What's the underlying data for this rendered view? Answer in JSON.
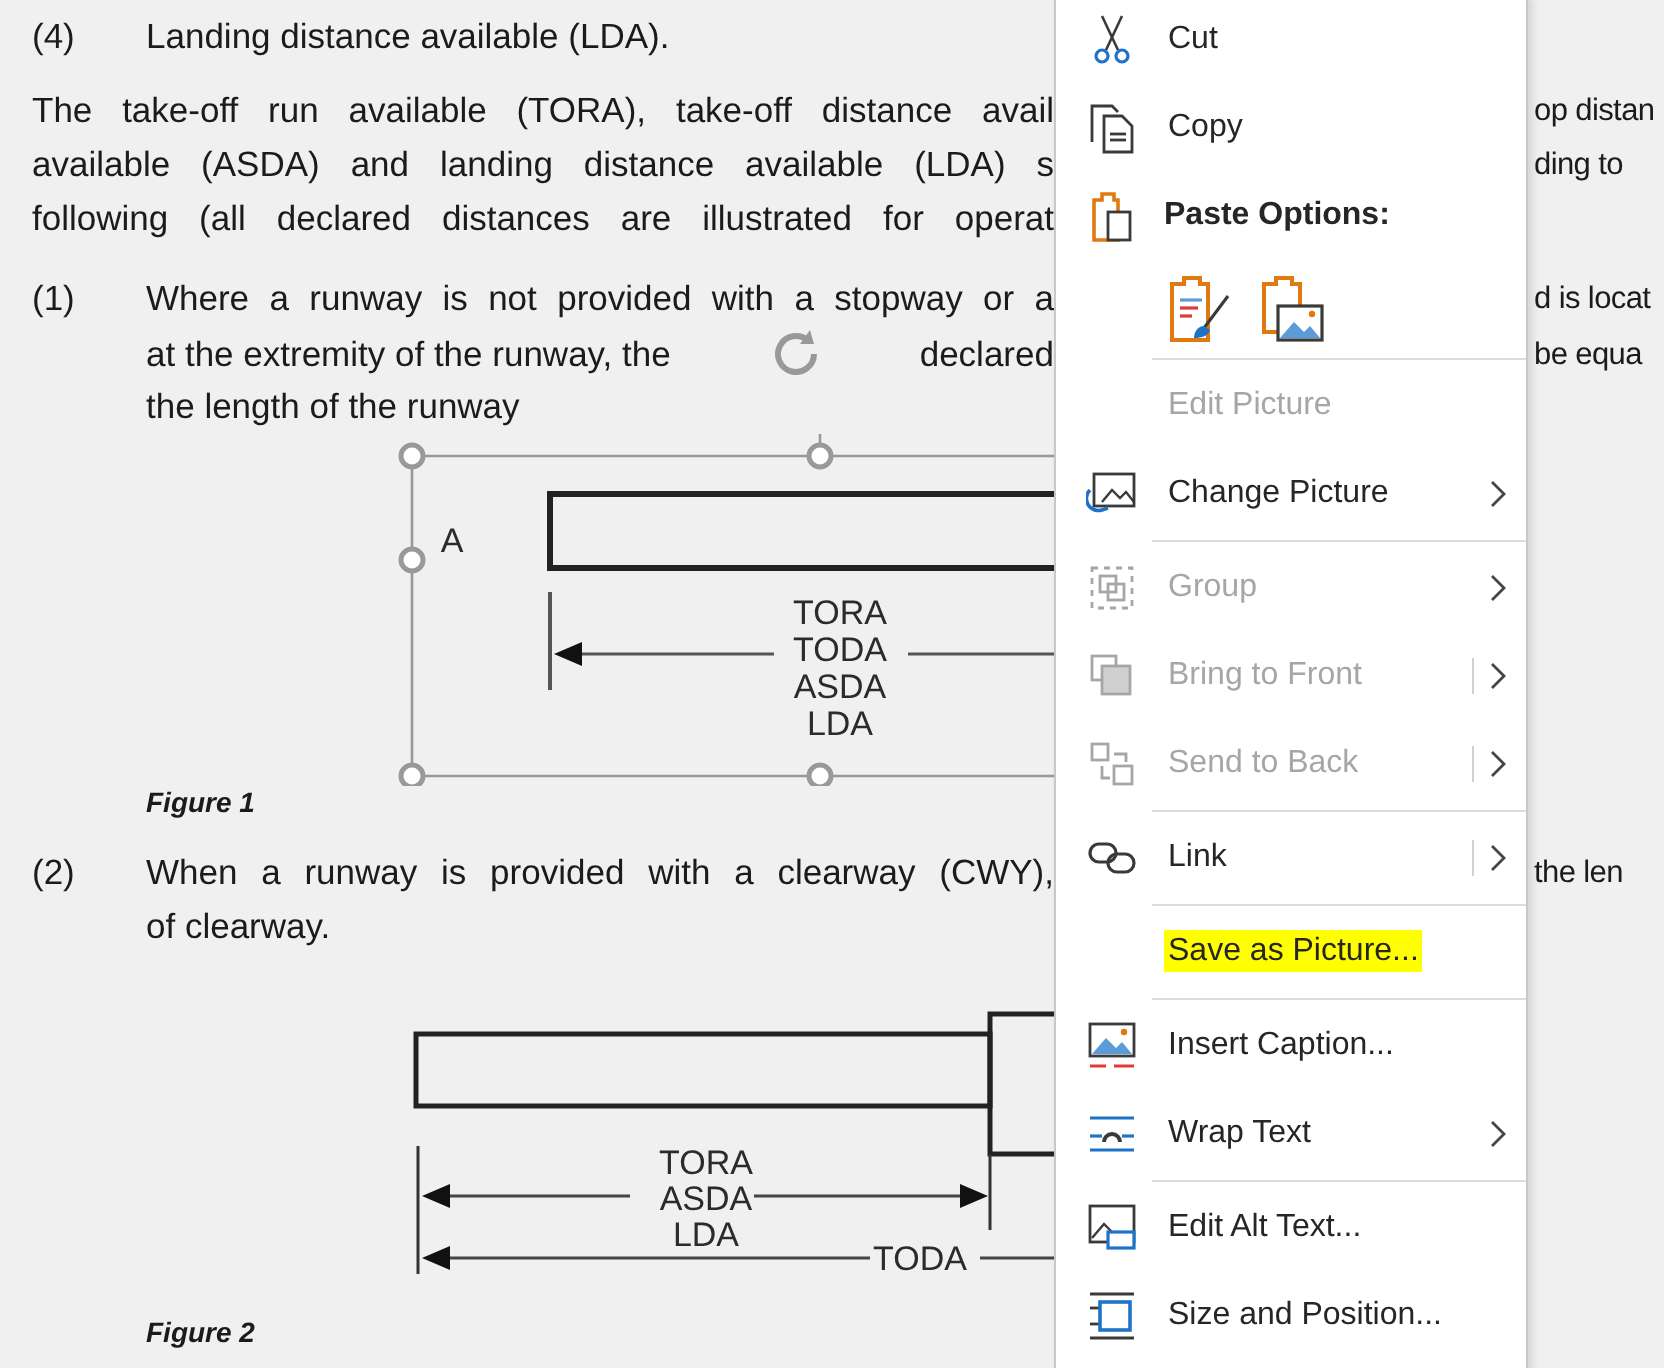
{
  "document": {
    "blocks": [
      {
        "kind": "numbered",
        "number": "(4)",
        "lines": [
          {
            "segments": [
              "Landing distance available (LDA)."
            ]
          }
        ]
      },
      {
        "kind": "paragraph",
        "lines": [
          {
            "segments": [
              "The take-off run available (TORA), take-off distance avail"
            ],
            "right": "op distan"
          },
          {
            "segments": [
              "available (ASDA) and landing distance available (LDA) s"
            ],
            "right": "ding to"
          },
          {
            "segments": [
              "following (all declared distances are illustrated for operat"
            ]
          }
        ]
      },
      {
        "kind": "numbered",
        "number": "(1)",
        "lines": [
          {
            "segments": [
              "Where a runway is not provided with a stopway or a"
            ],
            "right": "d is locat"
          },
          {
            "segments": [
              "at the extremity of the runway, the",
              "declared"
            ],
            "right": "be equa"
          },
          {
            "segments": [
              "the length of the runway"
            ]
          }
        ]
      },
      {
        "kind": "figure",
        "selected": true,
        "labels": [
          "A",
          "TORA",
          "TODA",
          "ASDA",
          "LDA"
        ],
        "caption": "Figure 1"
      },
      {
        "kind": "numbered",
        "number": "(2)",
        "lines": [
          {
            "segments": [
              "When a runway is provided with a clearway (CWY),"
            ],
            "right": "the len"
          },
          {
            "segments": [
              "of clearway."
            ]
          }
        ]
      },
      {
        "kind": "figure",
        "selected": false,
        "labels": [
          "TORA",
          "ASDA",
          "LDA",
          "TODA"
        ],
        "caption": "Figure 2"
      }
    ]
  },
  "context_menu": {
    "items": [
      {
        "kind": "command",
        "label": "Cut",
        "disabled": false,
        "submenu": false,
        "split": false,
        "highlighted": false
      },
      {
        "kind": "command",
        "label": "Copy",
        "disabled": false,
        "submenu": false,
        "split": false,
        "highlighted": false
      },
      {
        "kind": "heading",
        "label": "Paste Options:"
      },
      {
        "kind": "paste_icons"
      },
      {
        "kind": "separator"
      },
      {
        "kind": "command",
        "label": "Edit Picture",
        "disabled": true,
        "submenu": false,
        "split": false,
        "highlighted": false
      },
      {
        "kind": "command",
        "label": "Change Picture",
        "disabled": false,
        "submenu": true,
        "split": false,
        "highlighted": false
      },
      {
        "kind": "separator"
      },
      {
        "kind": "command",
        "label": "Group",
        "disabled": true,
        "submenu": true,
        "split": false,
        "highlighted": false
      },
      {
        "kind": "command",
        "label": "Bring to Front",
        "disabled": true,
        "submenu": true,
        "split": true,
        "highlighted": false
      },
      {
        "kind": "command",
        "label": "Send to Back",
        "disabled": true,
        "submenu": true,
        "split": true,
        "highlighted": false
      },
      {
        "kind": "separator"
      },
      {
        "kind": "command",
        "label": "Link",
        "disabled": false,
        "submenu": true,
        "split": true,
        "highlighted": false
      },
      {
        "kind": "separator"
      },
      {
        "kind": "command",
        "label": "Save as Picture...",
        "disabled": false,
        "submenu": false,
        "split": false,
        "highlighted": true
      },
      {
        "kind": "separator"
      },
      {
        "kind": "command",
        "label": "Insert Caption...",
        "disabled": false,
        "submenu": false,
        "split": false,
        "highlighted": false
      },
      {
        "kind": "command",
        "label": "Wrap Text",
        "disabled": false,
        "submenu": true,
        "split": false,
        "highlighted": false
      },
      {
        "kind": "separator"
      },
      {
        "kind": "command",
        "label": "Edit Alt Text...",
        "disabled": false,
        "submenu": false,
        "split": false,
        "highlighted": false
      },
      {
        "kind": "command",
        "label": "Size and Position...",
        "disabled": false,
        "submenu": false,
        "split": false,
        "highlighted": false
      }
    ]
  }
}
